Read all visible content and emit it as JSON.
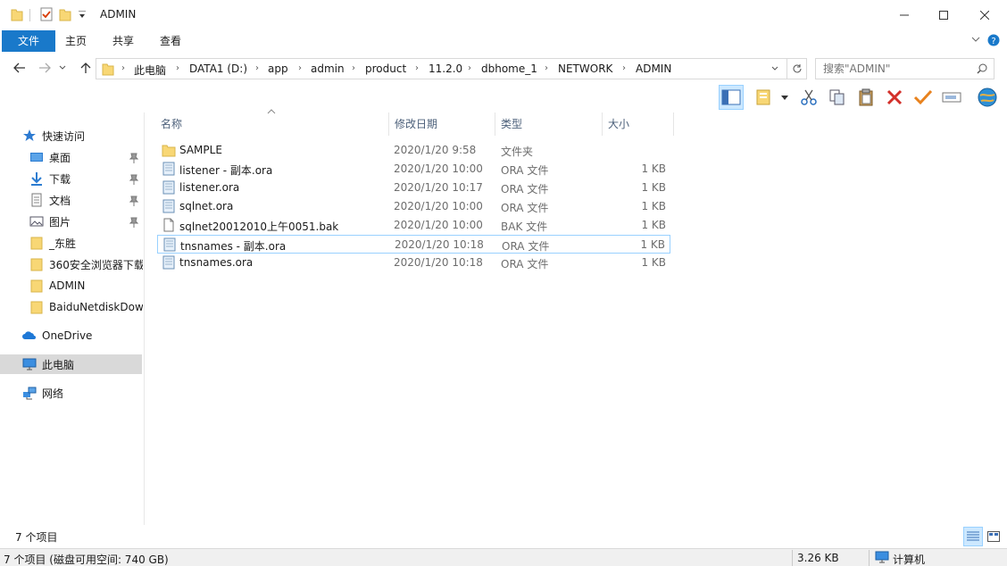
{
  "window": {
    "title": "ADMIN"
  },
  "ribbon": {
    "tabs": [
      "文件",
      "主页",
      "共享",
      "查看"
    ]
  },
  "breadcrumb": [
    "此电脑",
    "DATA1 (D:)",
    "app",
    "admin",
    "product",
    "11.2.0",
    "dbhome_1",
    "NETWORK",
    "ADMIN"
  ],
  "search": {
    "placeholder": "搜索\"ADMIN\""
  },
  "nav_pane": {
    "quick_access": "快速访问",
    "items": [
      {
        "label": "桌面",
        "icon": "desktop-icon",
        "pinned": true
      },
      {
        "label": "下载",
        "icon": "download-icon",
        "pinned": true
      },
      {
        "label": "文档",
        "icon": "document-icon",
        "pinned": true
      },
      {
        "label": "图片",
        "icon": "pictures-icon",
        "pinned": true
      },
      {
        "label": "_东胜",
        "icon": "folder-icon",
        "pinned": false
      },
      {
        "label": "360安全浏览器下载",
        "icon": "folder-icon",
        "pinned": false
      },
      {
        "label": "ADMIN",
        "icon": "folder-icon",
        "pinned": false
      },
      {
        "label": "BaiduNetdiskDownload",
        "icon": "folder-icon",
        "pinned": false
      }
    ],
    "onedrive": "OneDrive",
    "this_pc": "此电脑",
    "network": "网络"
  },
  "columns": {
    "name": "名称",
    "date": "修改日期",
    "type": "类型",
    "size": "大小"
  },
  "files": [
    {
      "name": "SAMPLE",
      "date": "2020/1/20 9:58",
      "type": "文件夹",
      "size": "",
      "icon": "folder-icon"
    },
    {
      "name": "listener - 副本.ora",
      "date": "2020/1/20 10:00",
      "type": "ORA 文件",
      "size": "1 KB",
      "icon": "ora-file-icon"
    },
    {
      "name": "listener.ora",
      "date": "2020/1/20 10:17",
      "type": "ORA 文件",
      "size": "1 KB",
      "icon": "ora-file-icon"
    },
    {
      "name": "sqlnet.ora",
      "date": "2020/1/20 10:00",
      "type": "ORA 文件",
      "size": "1 KB",
      "icon": "ora-file-icon"
    },
    {
      "name": "sqlnet20012010上午0051.bak",
      "date": "2020/1/20 10:00",
      "type": "BAK 文件",
      "size": "1 KB",
      "icon": "bak-file-icon"
    },
    {
      "name": "tnsnames - 副本.ora",
      "date": "2020/1/20 10:18",
      "type": "ORA 文件",
      "size": "1 KB",
      "icon": "ora-file-icon",
      "focused": true
    },
    {
      "name": "tnsnames.ora",
      "date": "2020/1/20 10:18",
      "type": "ORA 文件",
      "size": "1 KB",
      "icon": "ora-file-icon"
    }
  ],
  "item_count": "7 个项目",
  "status": {
    "summary": "7 个项目 (磁盘可用空间: 740 GB)",
    "size": "3.26 KB",
    "location": "计算机"
  },
  "colors": {
    "accent": "#1979ca",
    "folder": "#f8d775",
    "selected": "#d9d9d9"
  }
}
